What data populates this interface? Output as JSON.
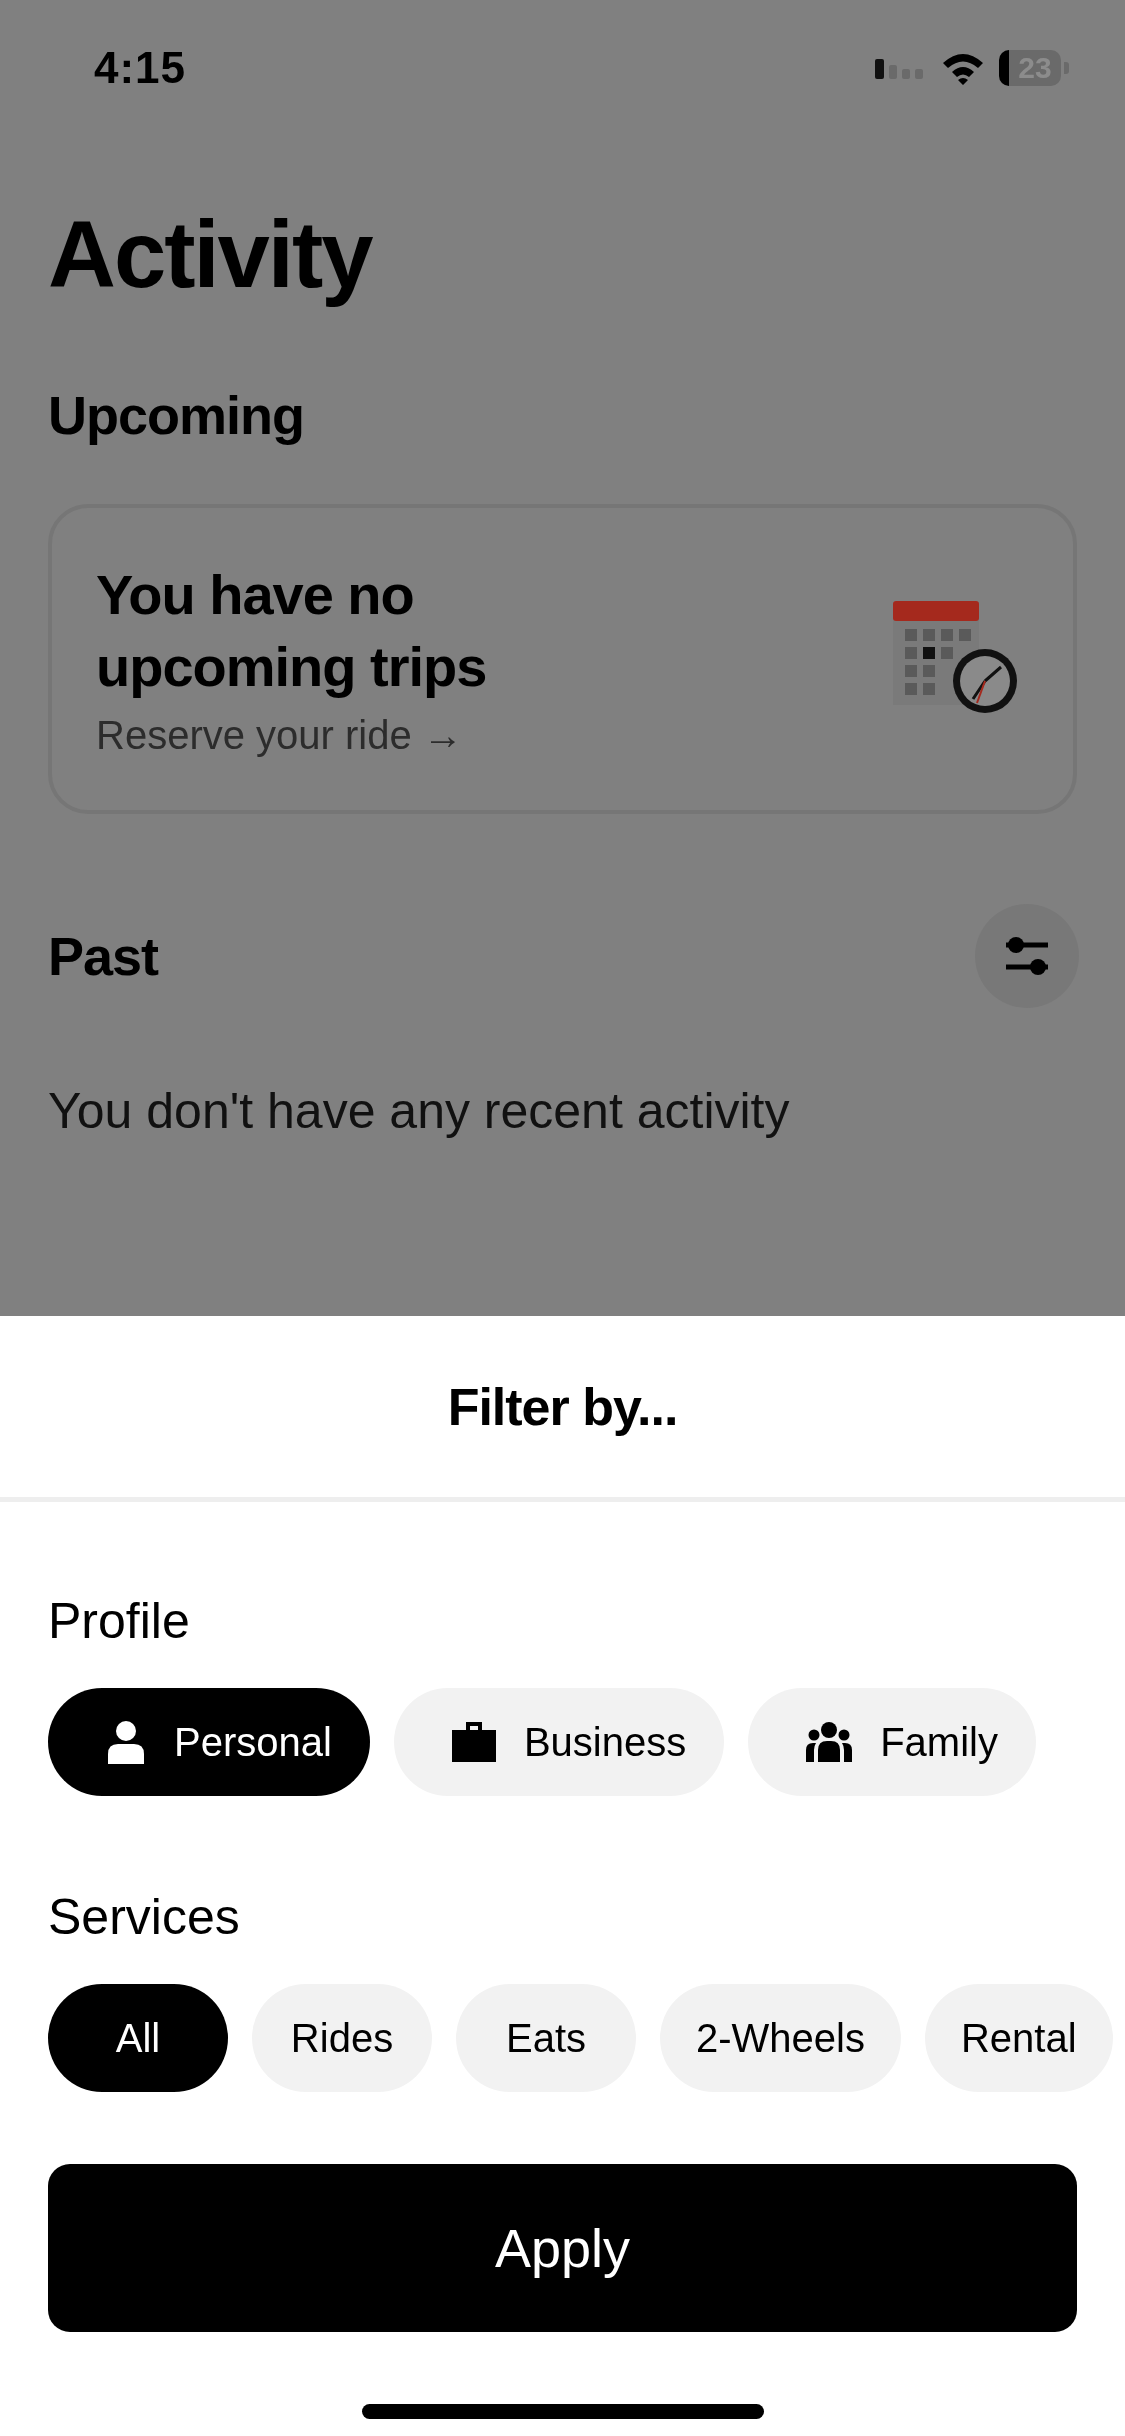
{
  "status_bar": {
    "time": "4:15",
    "battery": "23"
  },
  "title": "Activity",
  "upcoming": {
    "heading": "Upcoming",
    "card_title": "You have no upcoming trips",
    "link": "Reserve your ride →"
  },
  "past": {
    "heading": "Past",
    "empty_message": "You don't have any recent activity"
  },
  "filter_sheet": {
    "title": "Filter by...",
    "profile": {
      "heading": "Profile",
      "options": [
        {
          "label": "Personal",
          "kind": "person",
          "selected": true
        },
        {
          "label": "Business",
          "kind": "briefcase",
          "selected": false
        },
        {
          "label": "Family",
          "kind": "group",
          "selected": false
        }
      ]
    },
    "services": {
      "heading": "Services",
      "options": [
        {
          "label": "All",
          "selected": true
        },
        {
          "label": "Rides",
          "selected": false
        },
        {
          "label": "Eats",
          "selected": false
        },
        {
          "label": "2-Wheels",
          "selected": false
        },
        {
          "label": "Rental",
          "selected": false
        }
      ]
    },
    "apply_button": "Apply"
  }
}
